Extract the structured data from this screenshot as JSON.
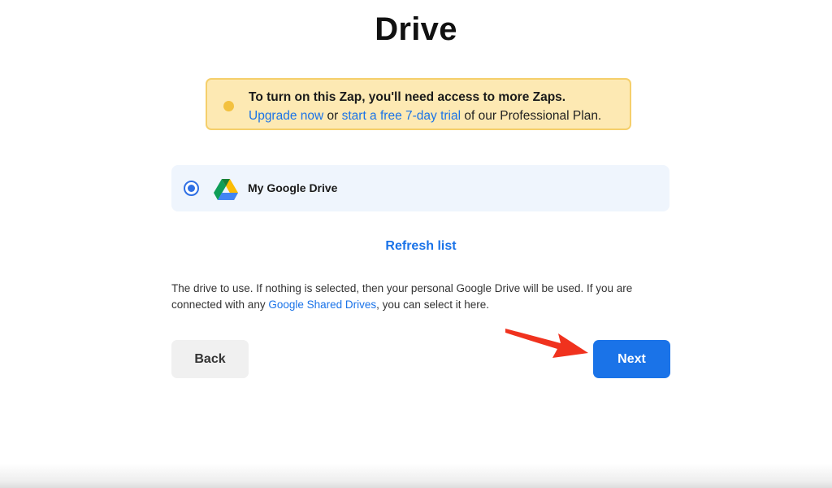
{
  "page": {
    "title": "Drive"
  },
  "alert": {
    "heading": "To turn on this Zap, you'll need access to more Zaps.",
    "upgrade_link": "Upgrade now",
    "or_text": " or ",
    "trial_link": "start a free 7-day trial",
    "suffix_text": " of our Professional Plan.",
    "icon": "warning-dot-icon",
    "background_color": "#fde9b3",
    "border_color": "#f5cf6b"
  },
  "drive_options": [
    {
      "label": "My Google Drive",
      "selected": true,
      "icon": "google-drive-icon"
    }
  ],
  "refresh": {
    "label": "Refresh list"
  },
  "help": {
    "text_before": "The drive to use. If nothing is selected, then your personal Google Drive will be used. If you are connected with any ",
    "link": "Google Shared Drives",
    "text_after": ", you can select it here."
  },
  "buttons": {
    "back_label": "Back",
    "next_label": "Next"
  },
  "colors": {
    "accent": "#1a73e8",
    "annotation_arrow": "#f0321e"
  }
}
